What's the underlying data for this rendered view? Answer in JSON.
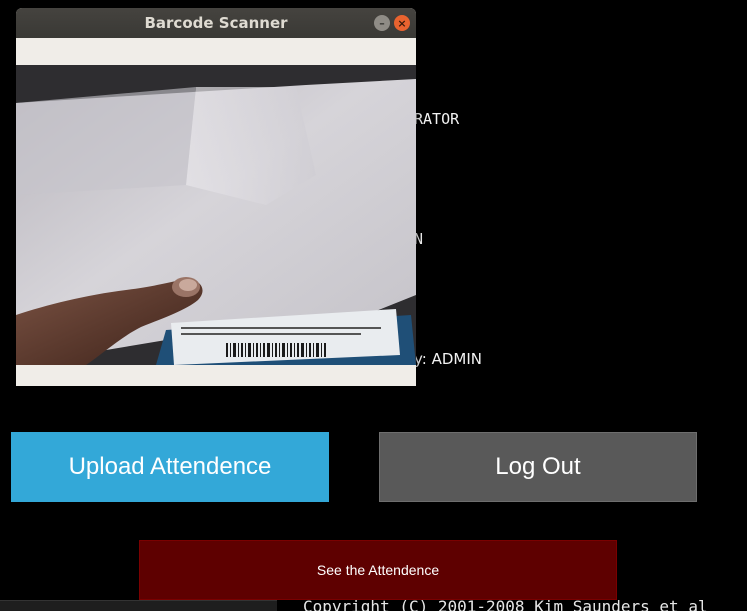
{
  "background": {
    "line1": "RATOR",
    "line2": "N",
    "line3": "y: ADMIN"
  },
  "buttons": {
    "upload": "Upload Attendence",
    "logout": "Log Out",
    "see": "See the Attendence"
  },
  "terminal": {
    "copyright": "Copyright (C) 2001-2008 Kim Saunders et al"
  },
  "window": {
    "title": "Barcode Scanner",
    "minimize_symbol": "–",
    "close_symbol": "×"
  },
  "colors": {
    "upload_bg": "#33a8d8",
    "logout_bg": "#595959",
    "see_bg": "#5e0000"
  }
}
